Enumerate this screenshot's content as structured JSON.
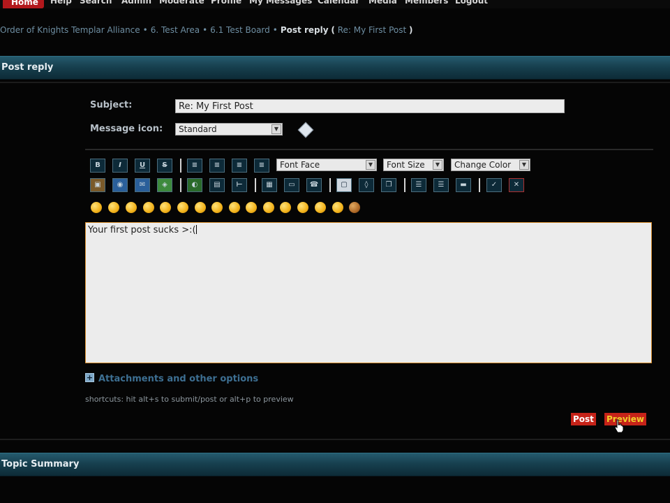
{
  "nav": {
    "items": [
      "Home",
      "Help",
      "Search",
      "Admin",
      "Moderate",
      "Profile",
      "My Messages",
      "Calendar",
      "Media",
      "Members",
      "Logout"
    ]
  },
  "breadcrumb": {
    "items": [
      "Order of Knights Templar Alliance",
      "6. Test Area",
      "6.1 Test Board"
    ],
    "current": "Post reply",
    "suffix_open": "(",
    "suffix_link": "Re: My First Post",
    "suffix_close": ")"
  },
  "post_reply": {
    "header": "Post reply",
    "subject_label": "Subject:",
    "subject_value": "Re: My First Post",
    "message_icon_label": "Message icon:",
    "message_icon_value": "Standard",
    "toolbar": {
      "format_buttons": [
        "B",
        "I",
        "U",
        "S"
      ],
      "font_face": "Font Face",
      "font_size": "Font Size",
      "change_color": "Change Color"
    },
    "message_text": "Your first post sucks  >:(",
    "attachments_label": "Attachments and other options",
    "shortcuts_text": "shortcuts: hit alt+s to submit/post or alt+p to preview",
    "post_button": "Post",
    "preview_button": "Preview"
  },
  "topic_summary": {
    "header": "Topic Summary"
  },
  "colors": {
    "accent_red": "#c62319",
    "header_teal": "#1c4a5c",
    "link_blue": "#3d6f92"
  }
}
